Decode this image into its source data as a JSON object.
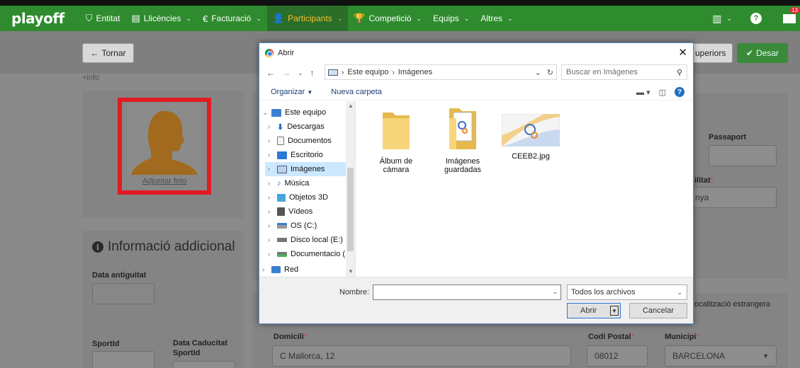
{
  "nav": {
    "brand": "playoff",
    "items": [
      {
        "label": "Entitat",
        "icon": "shield-icon"
      },
      {
        "label": "Llicències",
        "icon": "id-card-icon",
        "caret": "⌄"
      },
      {
        "label": "Facturació",
        "icon": "euro-icon",
        "caret": "⌄"
      },
      {
        "label": "Participants",
        "icon": "user-icon",
        "caret": "⌄",
        "active": true
      },
      {
        "label": "Competició",
        "icon": "trophy-icon",
        "caret": "⌄"
      },
      {
        "label": "Equips",
        "caret": "⌄"
      },
      {
        "label": "Altres",
        "caret": "⌄"
      }
    ],
    "notif_count": "13",
    "accent": "#2e8b2e"
  },
  "page": {
    "back_label": "Tornar",
    "superiors_label": "uperiors",
    "save_label": "Desar",
    "info_link": "+info",
    "adjuntar": "Adjuntar foto",
    "info_title": "Informació addicional",
    "data_antiguitat": "Data antiguitat",
    "sportid": "SportId",
    "data_caducitat": "Data Caducitat SportId",
    "passaport": "Passaport",
    "nacionalitat": "ilitat",
    "nacionalitat_value": "nya",
    "localitzacio": "ocalització estrangera",
    "domicili_label": "Domicili",
    "domicili_value": "C Mallorca, 12",
    "codi_postal_label": "Codi Postal",
    "codi_postal_value": "08012",
    "municipi_label": "Municipi",
    "municipi_value": "BARCELONA"
  },
  "dialog": {
    "title": "Abrir",
    "breadcrumb": [
      "Este equipo",
      "Imágenes"
    ],
    "search_placeholder": "Buscar en Imágenes",
    "organizar": "Organizar",
    "nueva_carpeta": "Nueva carpeta",
    "tree": [
      {
        "label": "Este equipo",
        "icon": "computer-icon",
        "expanded": true
      },
      {
        "label": "Descargas",
        "icon": "download-icon"
      },
      {
        "label": "Documentos",
        "icon": "document-icon"
      },
      {
        "label": "Escritorio",
        "icon": "desktop-icon"
      },
      {
        "label": "Imágenes",
        "icon": "pictures-icon",
        "selected": true
      },
      {
        "label": "Música",
        "icon": "music-icon"
      },
      {
        "label": "Objetos 3D",
        "icon": "cube-icon"
      },
      {
        "label": "Vídeos",
        "icon": "video-icon"
      },
      {
        "label": "OS (C:)",
        "icon": "drive-icon"
      },
      {
        "label": "Disco local (E:)",
        "icon": "disk-icon"
      },
      {
        "label": "Documentacio (",
        "icon": "network-drive-icon"
      },
      {
        "label": "Red",
        "icon": "network-icon"
      }
    ],
    "files": [
      {
        "name": "Álbum de cámara",
        "kind": "folder"
      },
      {
        "name": "Imágenes guardadas",
        "kind": "folder-with-image"
      },
      {
        "name": "CEEB2.jpg",
        "kind": "image"
      }
    ],
    "filename_label": "Nombre:",
    "filename_value": "",
    "filetype": "Todos los archivos",
    "open_label": "Abrir",
    "cancel_label": "Cancelar"
  }
}
